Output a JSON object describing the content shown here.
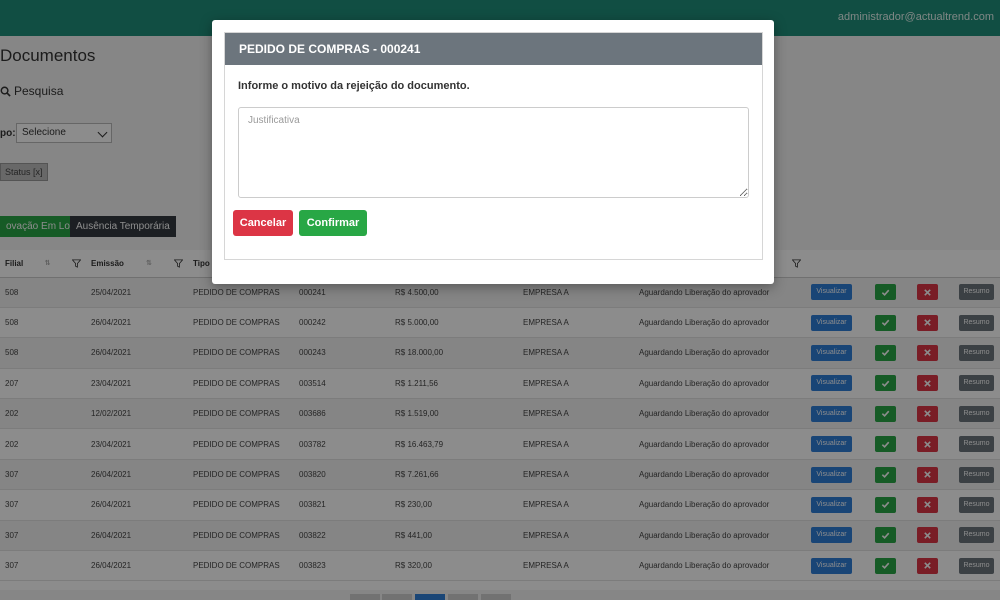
{
  "header": {
    "user_email": "administrador@actualtrend.com"
  },
  "page": {
    "title": "Documentos",
    "search_label": "Pesquisa",
    "filter_label": "po:",
    "filter_value": "Selecione",
    "status_tag": "Status [x]",
    "btn_lote": "ovação Em Lote",
    "btn_ausencia": "Ausência Temporária"
  },
  "table": {
    "headers": [
      "Filial",
      "Emissão",
      "Tipo"
    ],
    "rows": [
      {
        "filial": "508",
        "emissao": "25/04/2021",
        "tipo": "PEDIDO DE COMPRAS",
        "numero": "000241",
        "valor": "R$   4.500,00",
        "empresa": "EMPRESA A",
        "status": "Aguardando Liberação do aprovador"
      },
      {
        "filial": "508",
        "emissao": "26/04/2021",
        "tipo": "PEDIDO DE COMPRAS",
        "numero": "000242",
        "valor": "R$   5.000,00",
        "empresa": "EMPRESA A",
        "status": "Aguardando Liberação do aprovador"
      },
      {
        "filial": "508",
        "emissao": "26/04/2021",
        "tipo": "PEDIDO DE COMPRAS",
        "numero": "000243",
        "valor": "R$   18.000,00",
        "empresa": "EMPRESA A",
        "status": "Aguardando Liberação do aprovador"
      },
      {
        "filial": "207",
        "emissao": "23/04/2021",
        "tipo": "PEDIDO DE COMPRAS",
        "numero": "003514",
        "valor": "R$   1.211,56",
        "empresa": "EMPRESA A",
        "status": "Aguardando Liberação do aprovador"
      },
      {
        "filial": "202",
        "emissao": "12/02/2021",
        "tipo": "PEDIDO DE COMPRAS",
        "numero": "003686",
        "valor": "R$   1.519,00",
        "empresa": "EMPRESA A",
        "status": "Aguardando Liberação do aprovador"
      },
      {
        "filial": "202",
        "emissao": "23/04/2021",
        "tipo": "PEDIDO DE COMPRAS",
        "numero": "003782",
        "valor": "R$   16.463,79",
        "empresa": "EMPRESA A",
        "status": "Aguardando Liberação do aprovador"
      },
      {
        "filial": "307",
        "emissao": "26/04/2021",
        "tipo": "PEDIDO DE COMPRAS",
        "numero": "003820",
        "valor": "R$   7.261,66",
        "empresa": "EMPRESA A",
        "status": "Aguardando Liberação do aprovador"
      },
      {
        "filial": "307",
        "emissao": "26/04/2021",
        "tipo": "PEDIDO DE COMPRAS",
        "numero": "003821",
        "valor": "R$   230,00",
        "empresa": "EMPRESA A",
        "status": "Aguardando Liberação do aprovador"
      },
      {
        "filial": "307",
        "emissao": "26/04/2021",
        "tipo": "PEDIDO DE COMPRAS",
        "numero": "003822",
        "valor": "R$   441,00",
        "empresa": "EMPRESA A",
        "status": "Aguardando Liberação do aprovador"
      },
      {
        "filial": "307",
        "emissao": "26/04/2021",
        "tipo": "PEDIDO DE COMPRAS",
        "numero": "003823",
        "valor": "R$   320,00",
        "empresa": "EMPRESA A",
        "status": "Aguardando Liberação do aprovador"
      }
    ],
    "btn_visualizar": "Visualizar",
    "btn_resumo": "Resumo"
  },
  "modal": {
    "title": "PEDIDO DE COMPRAS - 000241",
    "message": "Informe o motivo da rejeição do documento.",
    "textarea_placeholder": "Justificativa",
    "cancel_label": "Cancelar",
    "confirm_label": "Confirmar"
  },
  "colors": {
    "topbar": "#1f8f7a",
    "modal_header": "#6c757d",
    "danger": "#dc3545",
    "success": "#28a745",
    "primary": "#2f7ed8"
  },
  "icons": {
    "search": "magnifier-icon",
    "filter": "funnel-icon",
    "approve": "check-icon",
    "reject": "close-icon"
  }
}
